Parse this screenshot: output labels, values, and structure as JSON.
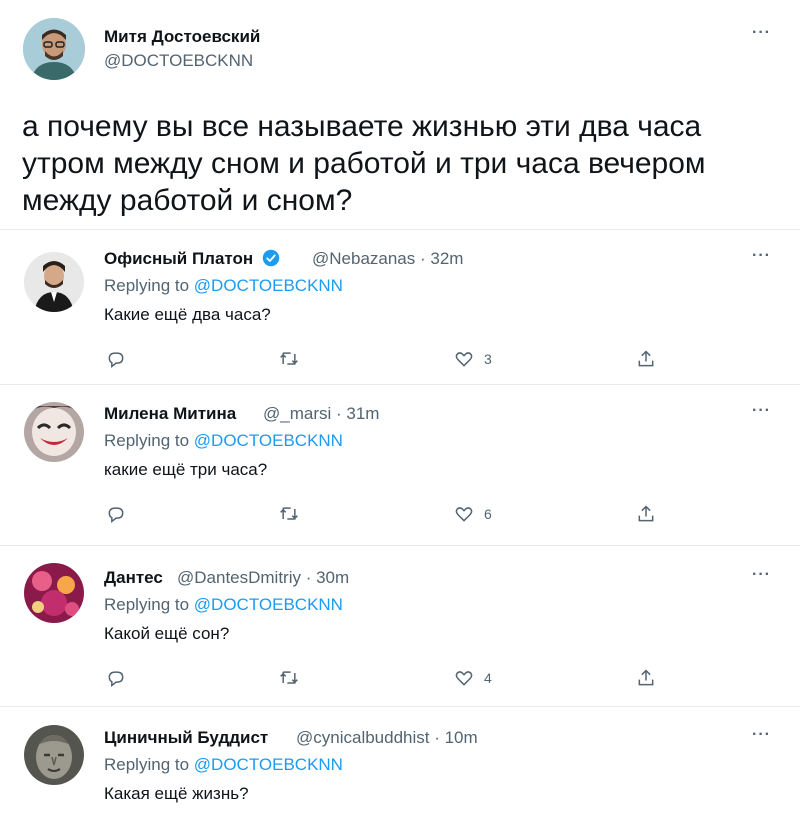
{
  "main": {
    "name": "Митя Достоевский",
    "handle": "@DOCTOEBCKNN",
    "text": "а почему вы все называете жизнью эти два часа утром между сном и работой и три часа вечером между работой и сном?",
    "more": "···"
  },
  "replies": [
    {
      "name": "Офисный Платон",
      "verified": true,
      "meta": "@Nebazanas · 32m",
      "replying_prefix": "Replying to ",
      "replying_to": "@DOCTOEBCKNN",
      "text": "Какие ещё два часа?",
      "likes": "3",
      "more": "···",
      "avatar_color": "#d9d9d9"
    },
    {
      "name": "Милена Митина",
      "verified": false,
      "meta": "@_marsi · 31m",
      "replying_prefix": "Replying to ",
      "replying_to": "@DOCTOEBCKNN",
      "text": "какие ещё три часа?",
      "likes": "6",
      "more": "···",
      "avatar_color": "#c8a0a0"
    },
    {
      "name": "Дантес",
      "verified": false,
      "meta": "@DantesDmitriy · 30m",
      "replying_prefix": "Replying to ",
      "replying_to": "@DOCTOEBCKNN",
      "text": "Какой ещё сон?",
      "likes": "4",
      "more": "···",
      "avatar_color": "#b2437a"
    },
    {
      "name": "Циничный Буддист",
      "verified": false,
      "meta": "@cynicalbuddhist · 10m",
      "replying_prefix": "Replying to ",
      "replying_to": "@DOCTOEBCKNN",
      "text": "Какая ещё жизнь?",
      "more": "···",
      "avatar_color": "#6f6f68"
    }
  ],
  "colors": {
    "link": "#1d9bf0",
    "muted": "#536471",
    "border": "#e6ecf0",
    "verified": "#1d9bf0"
  },
  "icons": [
    "reply-icon",
    "retweet-icon",
    "like-icon",
    "share-icon",
    "verified-badge-icon",
    "more-icon"
  ]
}
